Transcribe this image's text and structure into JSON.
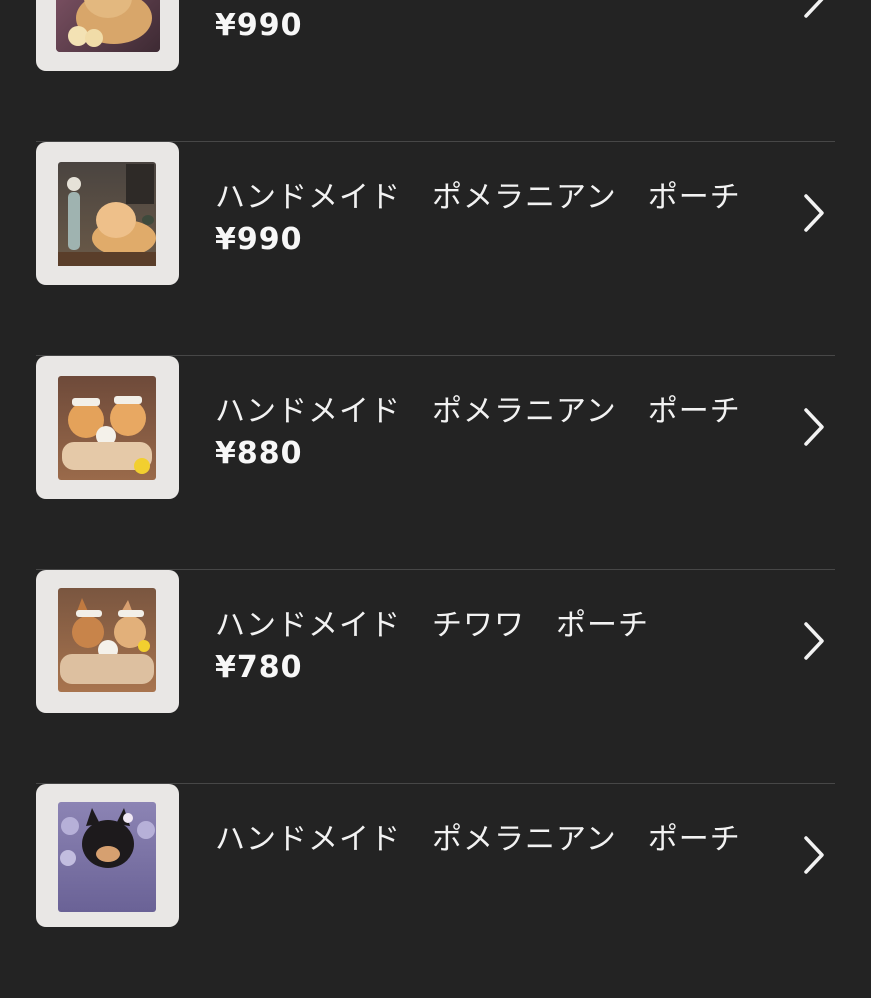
{
  "products": [
    {
      "title": "",
      "price": "¥990",
      "thumb_icon": "pomeranian-pouch-thumbnail"
    },
    {
      "title": "ハンドメイド　ポメラニアン　ポーチ",
      "price": "¥990",
      "thumb_icon": "pomeranian-pouch-thumbnail"
    },
    {
      "title": "ハンドメイド　ポメラニアン　ポーチ",
      "price": "¥880",
      "thumb_icon": "pomeranian-bath-pouch-thumbnail"
    },
    {
      "title": "ハンドメイド　チワワ　ポーチ",
      "price": "¥780",
      "thumb_icon": "chihuahua-bath-pouch-thumbnail"
    },
    {
      "title": "ハンドメイド　ポメラニアン　ポーチ",
      "price": "",
      "thumb_icon": "black-pomeranian-pouch-thumbnail"
    }
  ],
  "chevron_icon": "chevron-right-icon",
  "colors": {
    "background": "#232323",
    "divider": "#474747",
    "text": "#f2f2f2",
    "thumb_frame": "#e9e7e5"
  }
}
